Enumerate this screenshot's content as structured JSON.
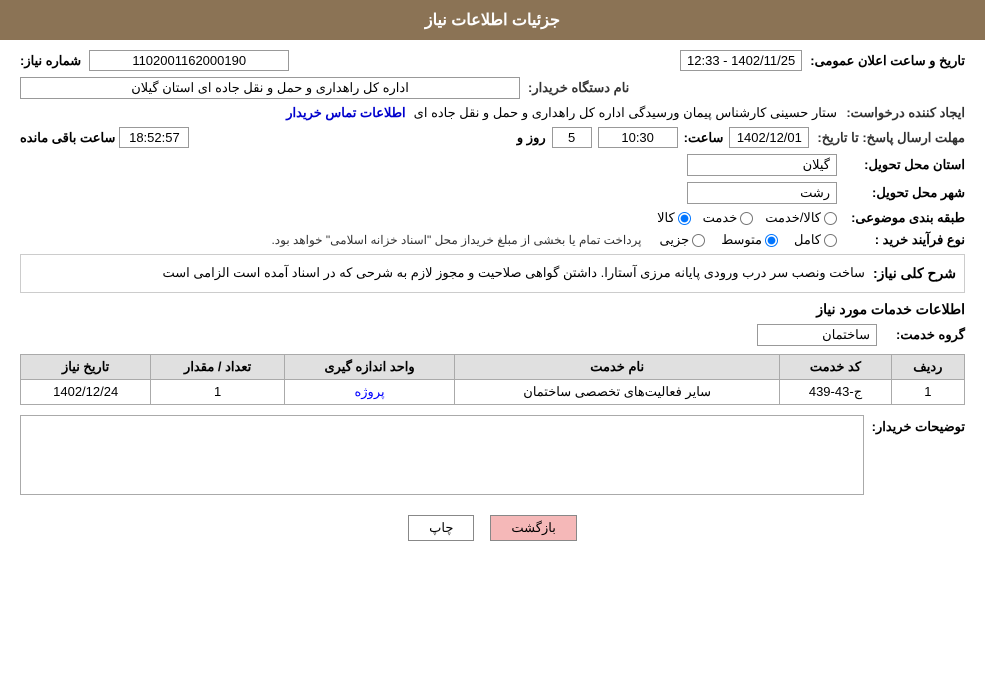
{
  "header": {
    "title": "جزئیات اطلاعات نیاز"
  },
  "topInfo": {
    "numberLabel": "شماره نیاز:",
    "numberValue": "1102001162000190",
    "dateLabel": "تاریخ و ساعت اعلان عمومی:",
    "dateValue": "1402/11/25 - 12:33"
  },
  "orgInfo": {
    "label": "نام دستگاه خریدار:",
    "value": "اداره کل راهداری و حمل و نقل جاده ای استان گیلان"
  },
  "creatorInfo": {
    "label": "ایجاد کننده درخواست:",
    "value": "ستار حسینی کارشناس پیمان ورسیدگی اداره کل راهداری و حمل و نقل جاده ای",
    "linkText": "اطلاعات تماس خریدار"
  },
  "deadlineInfo": {
    "label": "مهلت ارسال پاسخ: تا تاریخ:",
    "dateValue": "1402/12/01",
    "timeLabel": "ساعت:",
    "timeValue": "10:30",
    "dayLabel": "روز و",
    "dayValue": "5",
    "remainingLabel": "ساعت باقی مانده",
    "remainingValue": "18:52:57"
  },
  "provinceInfo": {
    "label": "استان محل تحویل:",
    "value": "گیلان"
  },
  "cityInfo": {
    "label": "شهر محل تحویل:",
    "value": "رشت"
  },
  "categoryInfo": {
    "label": "طبقه بندی موضوعی:",
    "options": [
      "کالا",
      "خدمت",
      "کالا/خدمت"
    ],
    "selected": "کالا"
  },
  "processInfo": {
    "label": "نوع فرآیند خرید :",
    "options": [
      "جزیی",
      "متوسط",
      "کامل"
    ],
    "selected": "متوسط",
    "note": "پرداخت تمام یا بخشی از مبلغ خریداز محل \"اسناد خزانه اسلامی\" خواهد بود."
  },
  "description": {
    "sectionLabel": "شرح کلی نیاز:",
    "text": "ساخت ونصب سر درب ورودی پایانه مرزی آستارا. داشتن گواهی صلاحیت و مجوز لازم به شرحی که در اسناد آمده است الزامی است"
  },
  "servicesSection": {
    "title": "اطلاعات خدمات مورد نیاز",
    "groupLabel": "گروه خدمت:",
    "groupValue": "ساختمان",
    "tableHeaders": [
      "ردیف",
      "کد خدمت",
      "نام خدمت",
      "واحد اندازه گیری",
      "تعداد / مقدار",
      "تاریخ نیاز"
    ],
    "rows": [
      {
        "row": "1",
        "code": "ج-43-439",
        "name": "سایر فعالیت‌های تخصصی ساختمان",
        "unit": "پروژه",
        "count": "1",
        "date": "1402/12/24"
      }
    ]
  },
  "buyerDescription": {
    "label": "توضیحات خریدار:",
    "value": ""
  },
  "buttons": {
    "back": "بازگشت",
    "print": "چاپ"
  }
}
